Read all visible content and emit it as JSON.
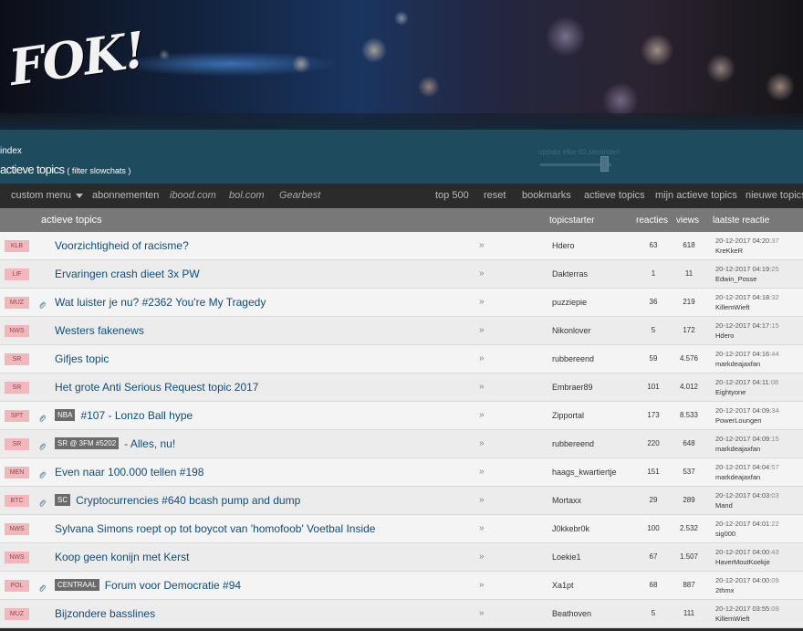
{
  "banner": {
    "logo_text": "FOK!"
  },
  "header": {
    "crumb_index": "index",
    "page_title": "actieve topics",
    "filter_label": "( filter slowchats )",
    "update_label": "update elke 60 seconden"
  },
  "nav": {
    "left": [
      "custom menu",
      "abonnementen",
      "ibood.com",
      "bol.com",
      "Gearbest"
    ],
    "right": [
      "top 500",
      "reset",
      "bookmarks",
      "actieve topics",
      "mijn actieve topics",
      "nieuwe topics"
    ]
  },
  "table": {
    "headers": {
      "topics": "actieve topics",
      "starter": "topicstarter",
      "reacties": "reacties",
      "views": "views",
      "laatste": "laatste reactie"
    },
    "arrow_glyph": "»",
    "rows": [
      {
        "cat": "KLB",
        "clip": false,
        "tag": "",
        "title": "Voorzichtigheid of racisme?",
        "starter": "Hdero",
        "reacties": "63",
        "views": "618",
        "date": "20-12-2017  04:20",
        "sec": ":37",
        "user": "KreKkeR"
      },
      {
        "cat": "LIF",
        "clip": false,
        "tag": "",
        "title": "Ervaringen crash dieet 3x PW",
        "starter": "Dakterras",
        "reacties": "1",
        "views": "11",
        "date": "20-12-2017  04:19",
        "sec": ":25",
        "user": "Edwin_Posse"
      },
      {
        "cat": "MUZ",
        "clip": true,
        "tag": "",
        "title": "Wat luister je nu? #2362 You're My Tragedy",
        "starter": "puzziepie",
        "reacties": "36",
        "views": "219",
        "date": "20-12-2017  04:18",
        "sec": ":32",
        "user": "KillemWieft"
      },
      {
        "cat": "NWS",
        "clip": false,
        "tag": "",
        "title": "Westers fakenews",
        "starter": "Nikonlover",
        "reacties": "5",
        "views": "172",
        "date": "20-12-2017  04:17",
        "sec": ":15",
        "user": "Hdero"
      },
      {
        "cat": "SR",
        "clip": false,
        "tag": "",
        "title": "Gifjes topic",
        "starter": "rubbereend",
        "reacties": "59",
        "views": "4.576",
        "date": "20-12-2017  04:16",
        "sec": ":44",
        "user": "markdeajaxfan"
      },
      {
        "cat": "SR",
        "clip": false,
        "tag": "",
        "title": "Het grote Anti Serious Request topic 2017",
        "starter": "Embraer89",
        "reacties": "101",
        "views": "4.012",
        "date": "20-12-2017  04:11",
        "sec": ":08",
        "user": "Eightyone"
      },
      {
        "cat": "SPT",
        "clip": true,
        "tag": "NBA",
        "title": "#107 - Lonzo Ball hype",
        "starter": "Zipportal",
        "reacties": "173",
        "views": "8.533",
        "date": "20-12-2017  04:09",
        "sec": ":34",
        "user": "PowerLoungen"
      },
      {
        "cat": "SR",
        "clip": true,
        "tag": "SR @ 3FM #5202",
        "title": "- Alles, nu!",
        "starter": "rubbereend",
        "reacties": "220",
        "views": "648",
        "date": "20-12-2017  04:09",
        "sec": ":15",
        "user": "markdeajaxfan"
      },
      {
        "cat": "MEN",
        "clip": true,
        "tag": "",
        "title": "Even naar 100.000 tellen #198",
        "starter": "haags_kwartiertje",
        "reacties": "151",
        "views": "537",
        "date": "20-12-2017  04:04",
        "sec": ":57",
        "user": "markdeajaxfan"
      },
      {
        "cat": "BTC",
        "clip": true,
        "tag": "SC",
        "title": "Cryptocurrencies #640 bcash pump and dump",
        "starter": "Mortaxx",
        "reacties": "29",
        "views": "289",
        "date": "20-12-2017  04:03",
        "sec": ":03",
        "user": "Mand"
      },
      {
        "cat": "NWS",
        "clip": false,
        "tag": "",
        "title": "Sylvana Simons roept op tot boycot van 'homofoob' Voetbal Inside",
        "starter": "J0kkebr0k",
        "reacties": "100",
        "views": "2.532",
        "date": "20-12-2017  04:01",
        "sec": ":22",
        "user": "sig000"
      },
      {
        "cat": "NWS",
        "clip": false,
        "tag": "",
        "title": "Koop geen konijn met Kerst",
        "starter": "Loekie1",
        "reacties": "67",
        "views": "1.507",
        "date": "20-12-2017  04:00",
        "sec": ":43",
        "user": "HaverMoutKoekje"
      },
      {
        "cat": "POL",
        "clip": true,
        "tag": "CENTRAAL",
        "title": "Forum voor Democratie #94",
        "starter": "Xa1pt",
        "reacties": "68",
        "views": "887",
        "date": "20-12-2017  04:00",
        "sec": ":09",
        "user": "2thmx"
      },
      {
        "cat": "MUZ",
        "clip": false,
        "tag": "",
        "title": "Bijzondere basslines",
        "starter": "Beathoven",
        "reacties": "5",
        "views": "111",
        "date": "20-12-2017  03:55",
        "sec": ":09",
        "user": "KillemWieft"
      }
    ]
  }
}
